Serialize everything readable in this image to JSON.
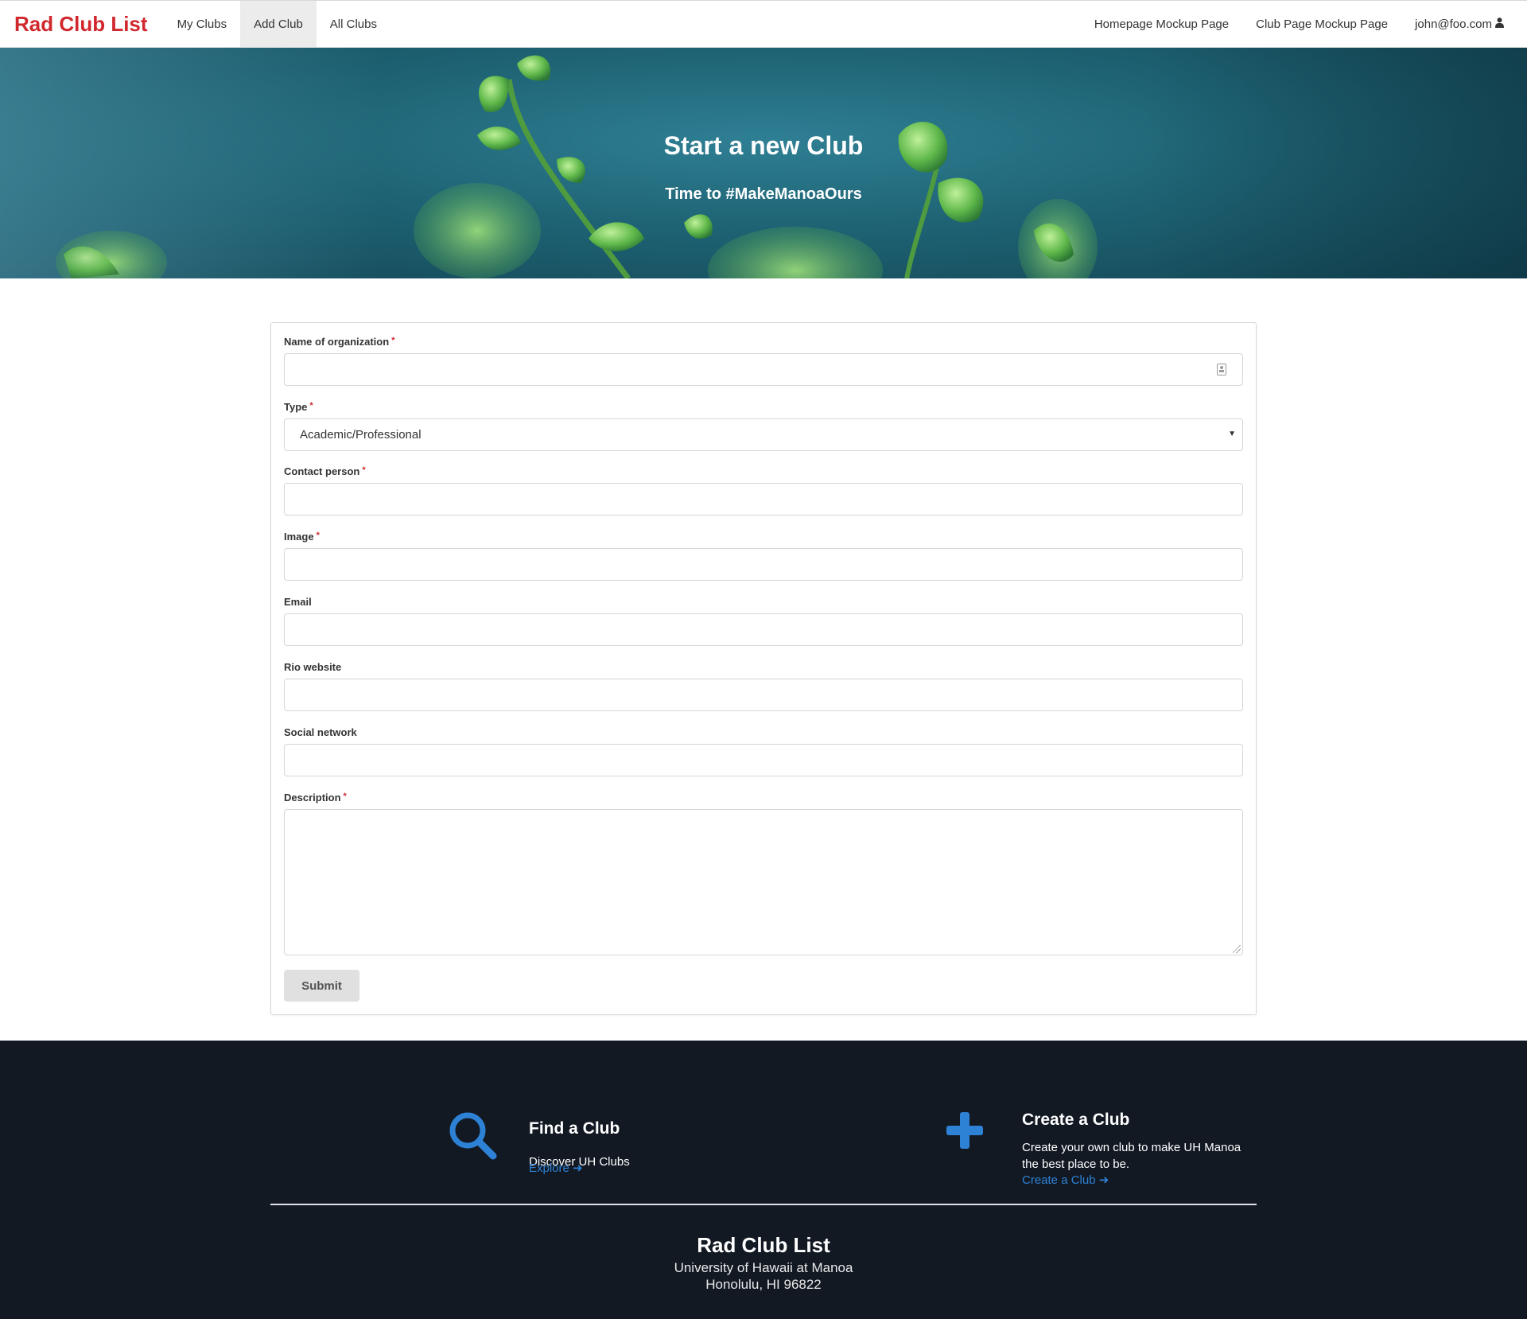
{
  "navbar": {
    "brand": "Rad Club List",
    "left_items": [
      "My Clubs",
      "Add Club",
      "All Clubs"
    ],
    "active_item": "Add Club",
    "right_items": [
      "Homepage Mockup Page",
      "Club Page Mockup Page"
    ],
    "user": "john@foo.com",
    "user_icon": "user-icon"
  },
  "hero": {
    "title": "Start a new Club",
    "subtitle": "Time to #MakeManoaOurs"
  },
  "form": {
    "fields": [
      {
        "label": "Name of organization",
        "required": true,
        "value": ""
      },
      {
        "label": "Type",
        "required": true,
        "value": "Academic/Professional"
      },
      {
        "label": "Contact person",
        "required": true,
        "value": ""
      },
      {
        "label": "Image",
        "required": true,
        "value": ""
      },
      {
        "label": "Email",
        "required": false,
        "value": ""
      },
      {
        "label": "Rio website",
        "required": false,
        "value": ""
      },
      {
        "label": "Social network",
        "required": false,
        "value": ""
      },
      {
        "label": "Description",
        "required": true,
        "value": ""
      }
    ],
    "required_marker": "*",
    "submit_label": "Submit"
  },
  "footer": {
    "find": {
      "title": "Find a Club",
      "text": "Discover UH Clubs",
      "link": "Explore",
      "icon": "search-icon"
    },
    "create": {
      "title": "Create a Club",
      "text_line1": "Create your own club to make UH Manoa",
      "text_line2": "the best place to be.",
      "link": "Create a Club",
      "icon": "plus-icon"
    },
    "brand": "Rad Club List",
    "address_line1": "University of Hawaii at Manoa",
    "address_line2": "Honolulu, HI 96822"
  },
  "colors": {
    "brand_red": "#d0282e",
    "link_blue": "#2e82d6",
    "footer_bg": "#121923"
  }
}
